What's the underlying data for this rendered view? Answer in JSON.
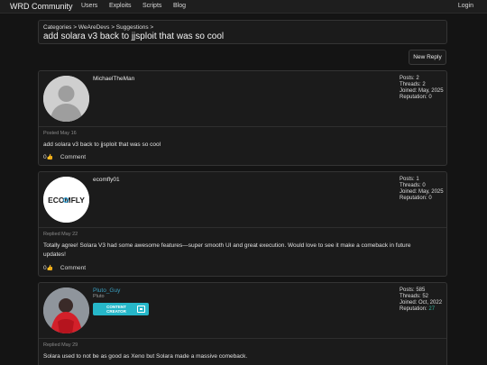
{
  "topbar": {
    "brand": "WRD Community",
    "nav": [
      "Users",
      "Exploits",
      "Scripts",
      "Blog"
    ],
    "login": "Login"
  },
  "thread": {
    "breadcrumb": "Categories > WeAreDevs > Suggestions >",
    "title": "add solara v3 back to jjsploit that was so cool",
    "new_reply": "New Reply"
  },
  "posts": [
    {
      "username": "MichaelTheMan",
      "avatar": "default-user-icon",
      "stats": [
        "Posts: 2",
        "Threads: 2",
        "Joined: May, 2025",
        "Reputation: 0"
      ],
      "meta": "Posted May 16",
      "body": "add solara v3 back to jjsploit that was so cool",
      "likes": "0",
      "comment": "Comment"
    },
    {
      "username": "ecomfly01",
      "avatar": "ECOMFLY",
      "stats": [
        "Posts: 1",
        "Threads: 0",
        "Joined: May, 2025",
        "Reputation: 0"
      ],
      "meta": "Replied May 22",
      "body_lines": [
        "Totally agree! Solara V3 had some awesome features—super smooth UI and great execution. Would love to see it make a comeback in future",
        "updates!"
      ],
      "likes": "0",
      "comment": "Comment"
    },
    {
      "username": "Pluto_Guy",
      "subtitle": "Pluto",
      "badge": [
        "CONTENT",
        "CREATOR"
      ],
      "stats": [
        "Posts: 585",
        "Threads: 52",
        "Joined: Oct, 2022"
      ],
      "reputation_label": "Reputation:",
      "reputation_value": "27",
      "meta": "Replied May 29",
      "body": "Solara used to not be as good as Xeno but Solara made a massive comeback."
    }
  ],
  "colors": {
    "background": "#141414",
    "panel": "#1b1b1b",
    "accent_link": "#3a9fc0",
    "badge": "#26b7c9",
    "reputation_positive": "#2fb39a"
  }
}
